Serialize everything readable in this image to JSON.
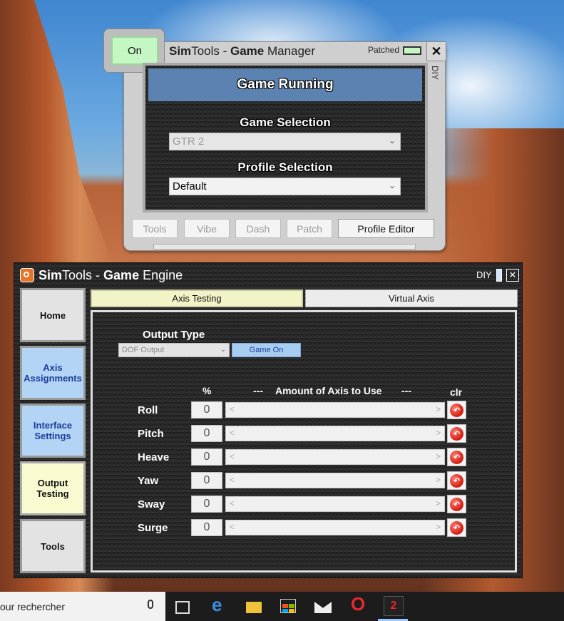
{
  "game_manager": {
    "on_button": "On",
    "title": {
      "prefix": "SimTools - ",
      "bold": "Game",
      "suffix": " Manager",
      "sim": "Sim",
      "tools": "Tools"
    },
    "patched_label": "Patched",
    "diy_label": "DIY",
    "close_glyph": "✕",
    "status": "Game Running",
    "game_selection_label": "Game Selection",
    "game_selection_value": "GTR 2",
    "profile_selection_label": "Profile Selection",
    "profile_selection_value": "Default",
    "buttons": {
      "tools": "Tools",
      "vibe": "Vibe",
      "dash": "Dash",
      "patch": "Patch",
      "profile_editor": "Profile Editor"
    },
    "colors": {
      "status_bg": "#5b82b0",
      "on_bg": "#c4f7c4"
    }
  },
  "game_engine": {
    "title_sim": "Sim",
    "title_tools": "Tools - ",
    "title_game": "Game",
    "title_engine": " Engine",
    "diy_label": "DIY",
    "close_glyph": "✕",
    "nav": {
      "home": "Home",
      "axis_assignments": "Axis Assignments",
      "interface_settings": "Interface Settings",
      "output_testing": "Output Testing",
      "tools": "Tools"
    },
    "tabs": {
      "axis_testing": "Axis Testing",
      "virtual_axis": "Virtual Axis"
    },
    "output_type_label": "Output Type",
    "output_type_value": "DOF Output",
    "game_on_button": "Game On",
    "headers": {
      "percent": "%",
      "amount_dash_left": "---",
      "amount": "Amount of Axis to Use",
      "amount_dash_right": "---",
      "clr": "clr"
    },
    "axes": [
      {
        "name": "Roll",
        "value": "0"
      },
      {
        "name": "Pitch",
        "value": "0"
      },
      {
        "name": "Heave",
        "value": "0"
      },
      {
        "name": "Yaw",
        "value": "0"
      },
      {
        "name": "Sway",
        "value": "0"
      },
      {
        "name": "Surge",
        "value": "0"
      }
    ]
  },
  "taskbar": {
    "search_text": "our rechercher"
  }
}
